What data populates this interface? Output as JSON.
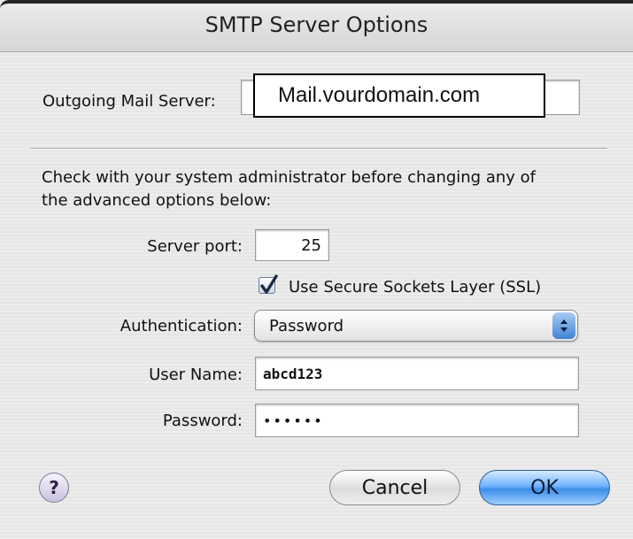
{
  "window": {
    "title": "SMTP Server Options"
  },
  "outgoing": {
    "label": "Outgoing Mail Server:",
    "value": "Mail.vourdomain.com"
  },
  "advanced_note": {
    "line1": "Check with your system administrator before changing any of",
    "line2": "the advanced options below:"
  },
  "port": {
    "label": "Server port:",
    "value": "25"
  },
  "ssl": {
    "label": "Use Secure Sockets Layer (SSL)",
    "checked": true
  },
  "auth": {
    "label": "Authentication:",
    "value": "Password"
  },
  "username": {
    "label": "User Name:",
    "value": "abcd123"
  },
  "password": {
    "label": "Password:",
    "value": "••••••"
  },
  "buttons": {
    "help": "?",
    "cancel": "Cancel",
    "ok": "OK"
  }
}
